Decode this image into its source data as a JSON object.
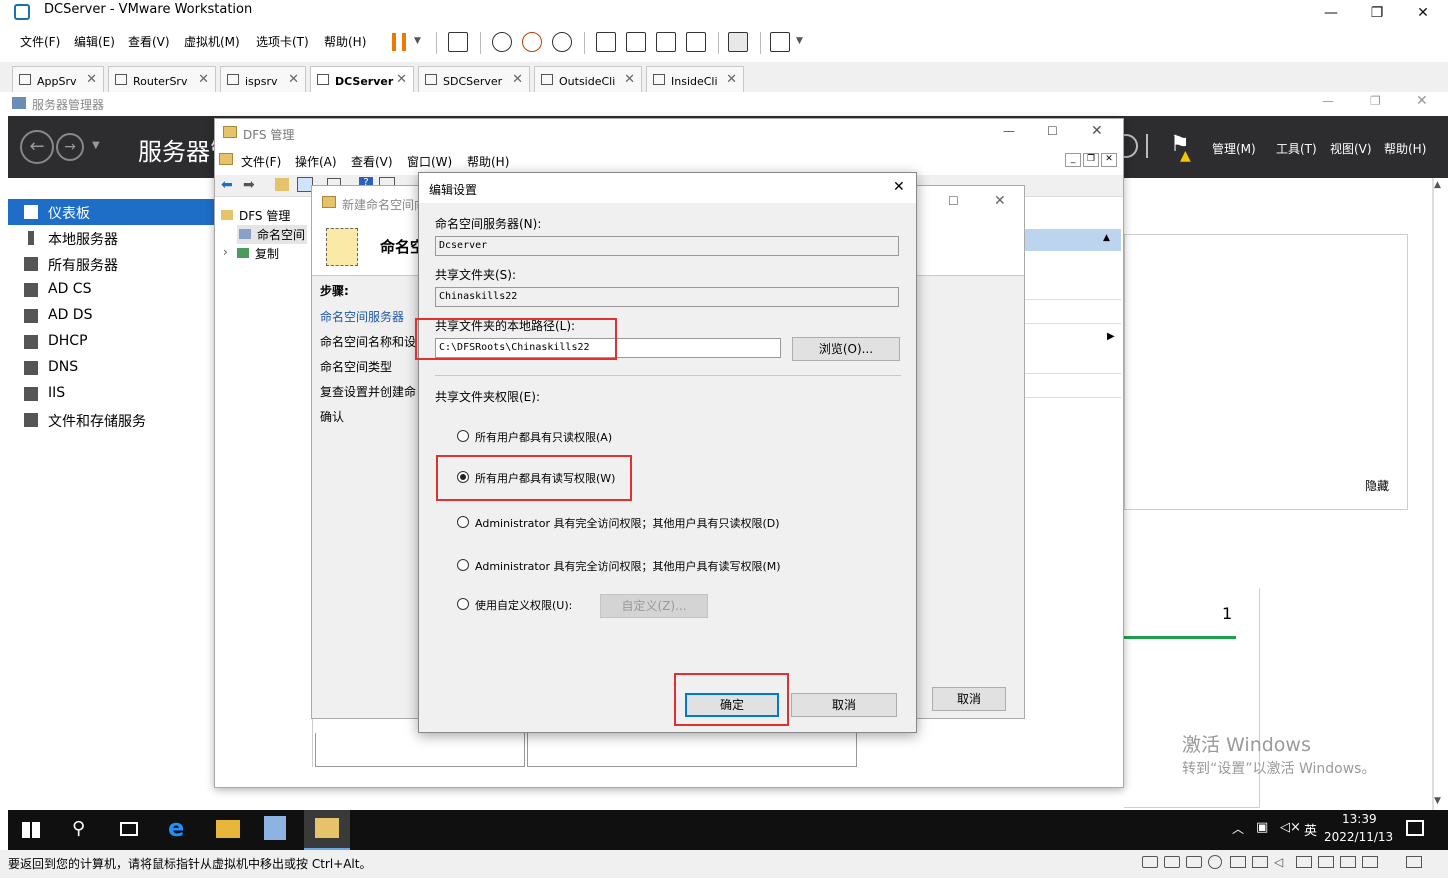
{
  "vmware": {
    "title": "DCServer - VMware Workstation",
    "menu": [
      "文件(F)",
      "编辑(E)",
      "查看(V)",
      "虚拟机(M)",
      "选项卡(T)",
      "帮助(H)"
    ],
    "tabs": [
      "AppSrv",
      "RouterSrv",
      "ispsrv",
      "DCServer",
      "SDCServer",
      "OutsideCli",
      "InsideCli"
    ],
    "active_tab": "DCServer",
    "status_text": "要返回到您的计算机，请将鼠标指针从虚拟机中移出或按 Ctrl+Alt。"
  },
  "server_manager": {
    "window_title": "服务器管理器",
    "header_title": "服务器管",
    "header_menu": [
      "管理(M)",
      "工具(T)",
      "视图(V)",
      "帮助(H)"
    ],
    "sidebar": [
      "仪表板",
      "本地服务器",
      "所有服务器",
      "AD CS",
      "AD DS",
      "DHCP",
      "DNS",
      "IIS",
      "文件和存储服务"
    ],
    "hide_label": "隐藏",
    "tile_count": "1"
  },
  "dfs": {
    "title": "DFS 管理",
    "menu": [
      "文件(F)",
      "操作(A)",
      "查看(V)",
      "窗口(W)",
      "帮助(H)"
    ],
    "tree": {
      "root": "DFS 管理",
      "namespace": "命名空间",
      "replication": "复制"
    }
  },
  "wizard": {
    "title": "新建命名空间向导",
    "heading": "命名空",
    "steps_label": "步骤:",
    "steps": [
      "命名空间服务器",
      "命名空间名称和设",
      "命名空间类型",
      "复查设置并创建命",
      "确认"
    ],
    "cancel_label": "取消"
  },
  "dialog": {
    "title": "编辑设置",
    "server_label": "命名空间服务器(N):",
    "server_value": "Dcserver",
    "share_label": "共享文件夹(S):",
    "share_value": "Chinaskills22",
    "path_label": "共享文件夹的本地路径(L):",
    "path_value": "C:\\DFSRoots\\Chinaskills22",
    "browse_label": "浏览(O)...",
    "perm_label": "共享文件夹权限(E):",
    "options": [
      "所有用户都具有只读权限(A)",
      "所有用户都具有读写权限(W)",
      "Administrator 具有完全访问权限；其他用户具有只读权限(D)",
      "Administrator 具有完全访问权限；其他用户具有读写权限(M)",
      "使用自定义权限(U):"
    ],
    "selected_option_index": 1,
    "custom_label": "自定义(Z)...",
    "ok_label": "确定",
    "cancel_label": "取消"
  },
  "windows": {
    "activation_line1": "激活 Windows",
    "activation_line2": "转到“设置”以激活 Windows。",
    "tray_ime": "英",
    "clock_time": "13:39",
    "clock_date": "2022/11/13"
  },
  "colors": {
    "accent": "#1e6ec8",
    "highlight": "#e03030",
    "header_bg": "#2d2d30"
  }
}
